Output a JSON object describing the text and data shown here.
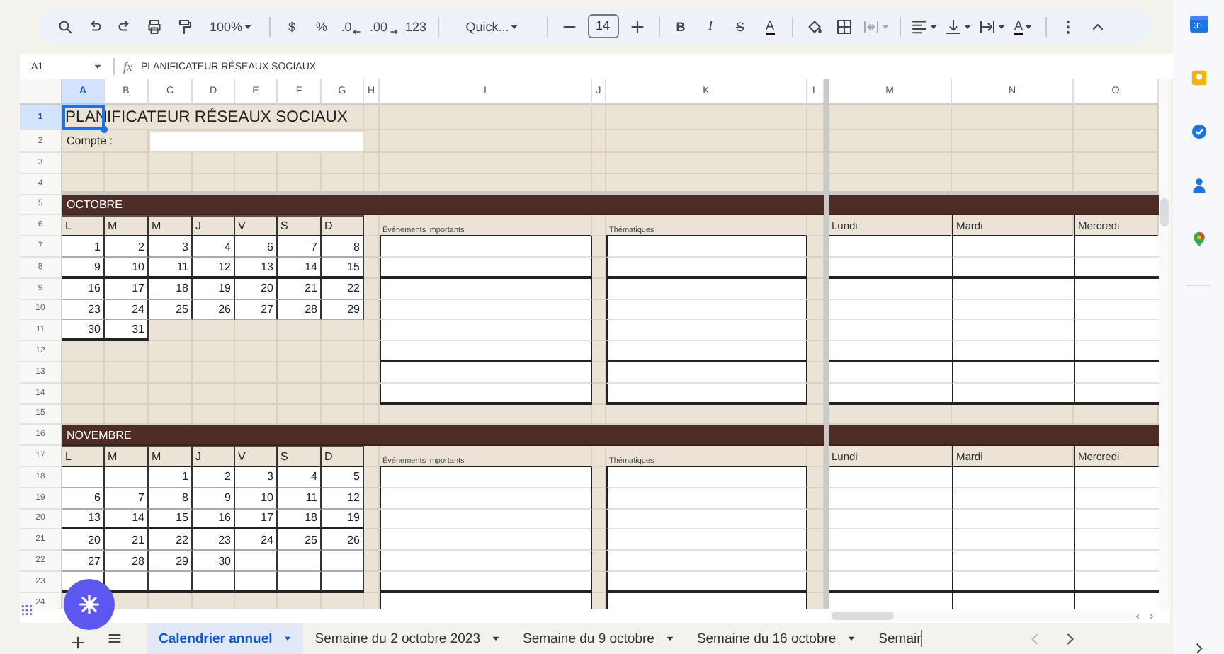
{
  "toolbar": {
    "zoom": "100%",
    "currency": "$",
    "percent": "%",
    "decrease_decimal": ".0",
    "increase_decimal": ".00",
    "number_format": "123",
    "font": "Quick...",
    "font_size": "14",
    "bold": "B",
    "italic": "I",
    "strikethrough": "S",
    "text_color": "A",
    "text_rotation": "A"
  },
  "side_panel": {
    "calendar_day": "31"
  },
  "formula_bar": {
    "cell_reference": "A1",
    "fx": "fx",
    "value": "PLANIFICATEUR RÉSEAUX SOCIAUX"
  },
  "sheet": {
    "columns": [
      {
        "label": "A",
        "selected": true
      },
      {
        "label": "B",
        "selected": false
      },
      {
        "label": "C",
        "selected": false
      },
      {
        "label": "D",
        "selected": false
      },
      {
        "label": "E",
        "selected": false
      },
      {
        "label": "F",
        "selected": false
      },
      {
        "label": "G",
        "selected": false
      },
      {
        "label": "H",
        "selected": false
      },
      {
        "label": "I",
        "selected": false
      },
      {
        "label": "J",
        "selected": false
      },
      {
        "label": "K",
        "selected": false
      },
      {
        "label": "L",
        "selected": false
      },
      {
        "label": "M",
        "selected": false
      },
      {
        "label": "N",
        "selected": false
      },
      {
        "label": "O",
        "selected": false
      }
    ],
    "rows": [
      {
        "label": "1",
        "selected": true
      },
      {
        "label": "2",
        "selected": false
      },
      {
        "label": "3",
        "selected": false
      },
      {
        "label": "4",
        "selected": false
      },
      {
        "label": "5",
        "selected": false
      },
      {
        "label": "6",
        "selected": false
      },
      {
        "label": "7",
        "selected": false
      },
      {
        "label": "8",
        "selected": false
      },
      {
        "label": "9",
        "selected": false
      },
      {
        "label": "10",
        "selected": false
      },
      {
        "label": "11",
        "selected": false
      },
      {
        "label": "12",
        "selected": false
      },
      {
        "label": "13",
        "selected": false
      },
      {
        "label": "14",
        "selected": false
      },
      {
        "label": "15",
        "selected": false
      },
      {
        "label": "16",
        "selected": false
      },
      {
        "label": "17",
        "selected": false
      },
      {
        "label": "18",
        "selected": false
      },
      {
        "label": "19",
        "selected": false
      },
      {
        "label": "20",
        "selected": false
      },
      {
        "label": "21",
        "selected": false
      },
      {
        "label": "22",
        "selected": false
      },
      {
        "label": "23",
        "selected": false
      },
      {
        "label": "24",
        "selected": false
      }
    ],
    "title": "PLANIFICATEUR RÉSEAUX SOCIAUX",
    "account_label": "Compte :",
    "months": [
      {
        "name": "OCTOBRE",
        "weekdays": [
          "L",
          "M",
          "M",
          "J",
          "V",
          "S",
          "D"
        ],
        "events_label": "Événements importants",
        "themes_label": "Thématiques",
        "days": [
          "Lundi",
          "Mardi",
          "Mercredi"
        ],
        "padded": false,
        "weeks": [
          [
            "1",
            "2",
            "3",
            "4",
            "6",
            "7",
            "8"
          ],
          [
            "9",
            "10",
            "11",
            "12",
            "13",
            "14",
            "15"
          ],
          [
            "16",
            "17",
            "18",
            "19",
            "20",
            "21",
            "22"
          ],
          [
            "23",
            "24",
            "25",
            "26",
            "27",
            "28",
            "29"
          ],
          [
            "30",
            "31"
          ]
        ]
      },
      {
        "name": "NOVEMBRE",
        "weekdays": [
          "L",
          "M",
          "M",
          "J",
          "V",
          "S",
          "D"
        ],
        "events_label": "Événements importants",
        "themes_label": "Thématiques",
        "days": [
          "Lundi",
          "Mardi",
          "Mercredi"
        ],
        "padded": true,
        "weeks": [
          [
            "1",
            "2",
            "3",
            "4",
            "5"
          ],
          [
            "6",
            "7",
            "8",
            "9",
            "10",
            "11",
            "12"
          ],
          [
            "13",
            "14",
            "15",
            "16",
            "17",
            "18",
            "19"
          ],
          [
            "20",
            "21",
            "22",
            "23",
            "24",
            "25",
            "26"
          ],
          [
            "27",
            "28",
            "29",
            "30"
          ]
        ]
      }
    ]
  },
  "tabs": [
    {
      "label": "Calendrier annuel",
      "selected": true,
      "truncated": false
    },
    {
      "label": "Semaine du 2 octobre 2023",
      "selected": false,
      "truncated": false
    },
    {
      "label": "Semaine du 9 octobre",
      "selected": false,
      "truncated": false
    },
    {
      "label": "Semaine du 16 octobre",
      "selected": false,
      "truncated": false
    },
    {
      "label": "Semair",
      "selected": false,
      "truncated": true
    }
  ]
}
